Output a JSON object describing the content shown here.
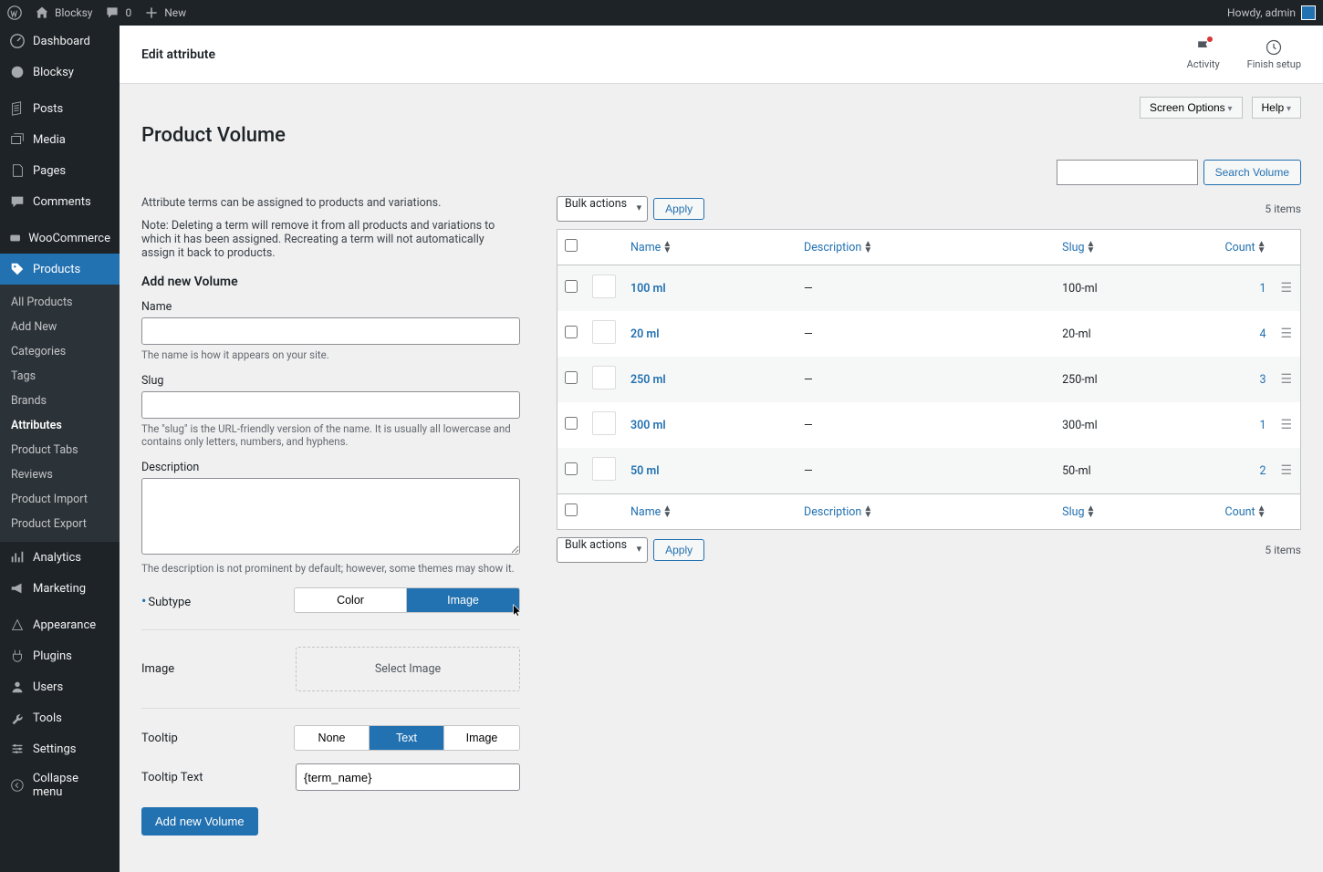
{
  "adminbar": {
    "site": "Blocksy",
    "comments": "0",
    "new": "New",
    "howdy": "Howdy, admin"
  },
  "sidebar": {
    "dashboard": "Dashboard",
    "blocksy": "Blocksy",
    "posts": "Posts",
    "media": "Media",
    "pages": "Pages",
    "comments": "Comments",
    "woocommerce": "WooCommerce",
    "products": "Products",
    "analytics": "Analytics",
    "marketing": "Marketing",
    "appearance": "Appearance",
    "plugins": "Plugins",
    "users": "Users",
    "tools": "Tools",
    "settings": "Settings",
    "collapse": "Collapse menu",
    "sub": {
      "all": "All Products",
      "addnew": "Add New",
      "categories": "Categories",
      "tags": "Tags",
      "brands": "Brands",
      "attributes": "Attributes",
      "tabs": "Product Tabs",
      "reviews": "Reviews",
      "import": "Product Import",
      "export": "Product Export"
    }
  },
  "topbar": {
    "title": "Edit attribute",
    "activity": "Activity",
    "finish": "Finish setup"
  },
  "tabs": {
    "screen": "Screen Options",
    "help": "Help"
  },
  "page": {
    "title": "Product Volume",
    "search_btn": "Search Volume",
    "intro": "Attribute terms can be assigned to products and variations.",
    "note": "Note: Deleting a term will remove it from all products and variations to which it has been assigned. Recreating a term will not automatically assign it back to products.",
    "add_heading": "Add new Volume",
    "name_label": "Name",
    "name_help": "The name is how it appears on your site.",
    "slug_label": "Slug",
    "slug_help": "The \"slug\" is the URL-friendly version of the name. It is usually all lowercase and contains only letters, numbers, and hyphens.",
    "desc_label": "Description",
    "desc_help": "The description is not prominent by default; however, some themes may show it.",
    "subtype_label": "Subtype",
    "subtype_color": "Color",
    "subtype_image": "Image",
    "image_label": "Image",
    "select_image": "Select Image",
    "tooltip_label": "Tooltip",
    "tooltip_none": "None",
    "tooltip_text": "Text",
    "tooltip_image": "Image",
    "tooltip_text_label": "Tooltip Text",
    "tooltip_text_value": "{term_name}",
    "submit": "Add new Volume"
  },
  "table": {
    "bulk": "Bulk actions",
    "apply": "Apply",
    "items": "5 items",
    "cols": {
      "name": "Name",
      "desc": "Description",
      "slug": "Slug",
      "count": "Count"
    },
    "rows": [
      {
        "name": "100 ml",
        "desc": "—",
        "slug": "100-ml",
        "count": "1"
      },
      {
        "name": "20 ml",
        "desc": "—",
        "slug": "20-ml",
        "count": "4"
      },
      {
        "name": "250 ml",
        "desc": "—",
        "slug": "250-ml",
        "count": "3"
      },
      {
        "name": "300 ml",
        "desc": "—",
        "slug": "300-ml",
        "count": "1"
      },
      {
        "name": "50 ml",
        "desc": "—",
        "slug": "50-ml",
        "count": "2"
      }
    ]
  }
}
